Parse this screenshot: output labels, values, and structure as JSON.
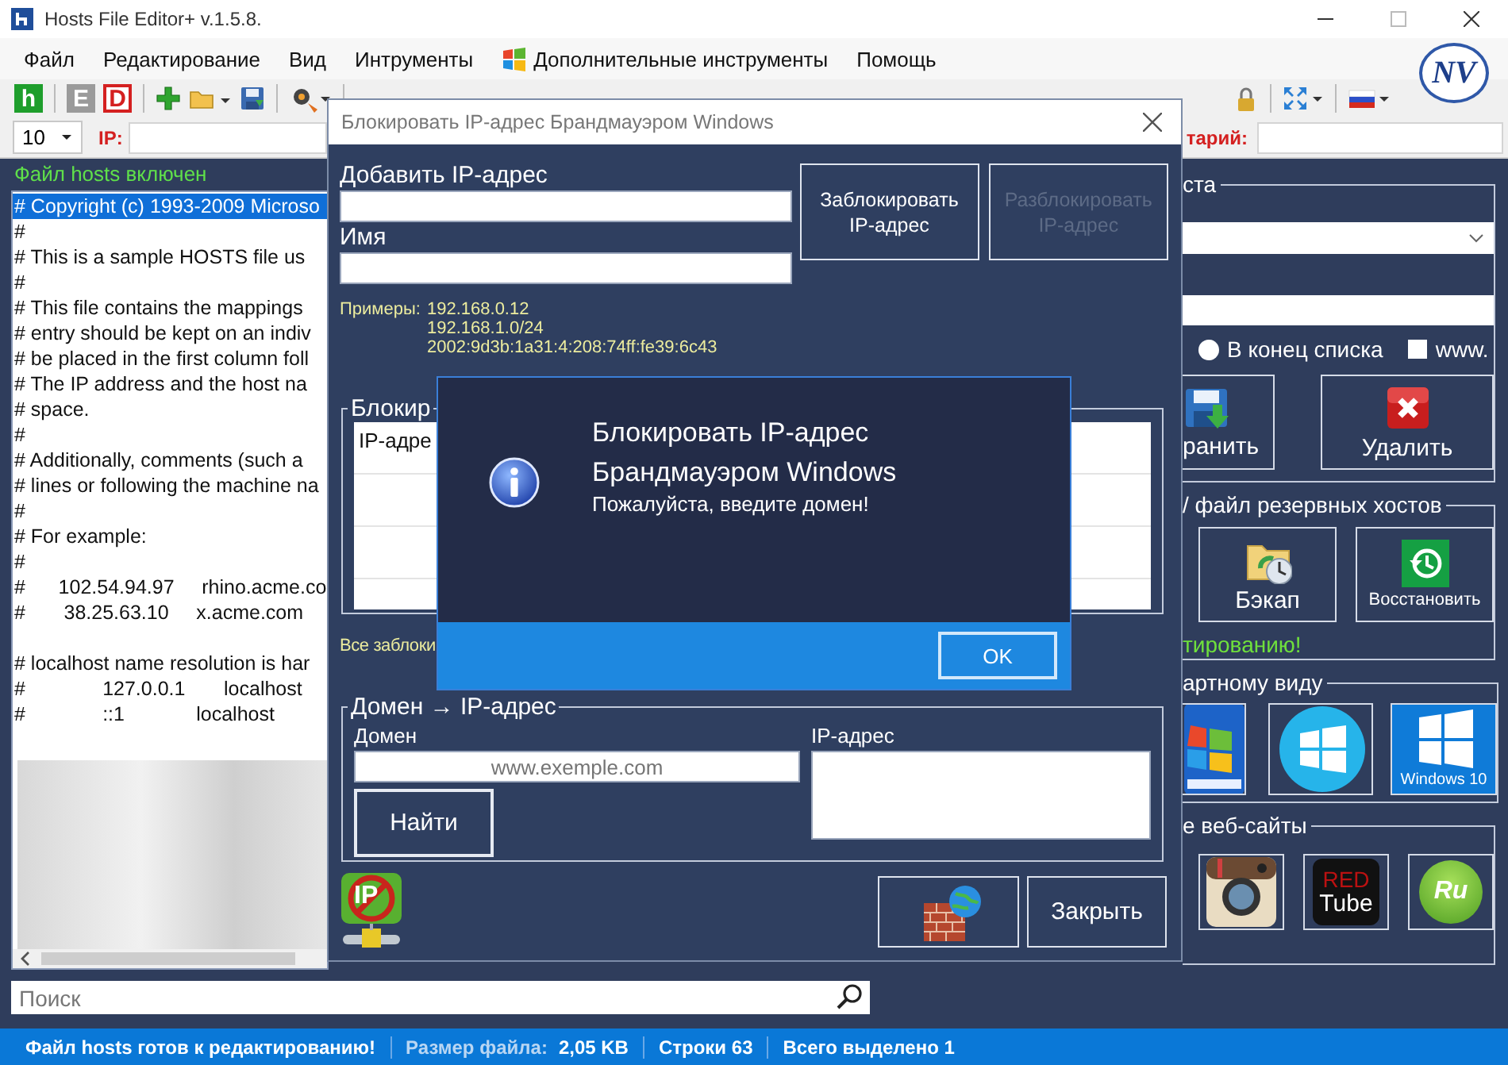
{
  "window": {
    "title": "Hosts File Editor+ v.1.5.8.",
    "logo": "NV"
  },
  "menu": [
    {
      "label": "Файл",
      "kind": "text"
    },
    {
      "label": "Редактирование",
      "kind": "text"
    },
    {
      "label": "Вид",
      "kind": "text"
    },
    {
      "label": "Интрументы",
      "kind": "text"
    },
    {
      "label": "Дополнительные инструменты",
      "kind": "icon_text"
    },
    {
      "label": "Помощь",
      "kind": "text"
    }
  ],
  "toolbar": {
    "letters": [
      {
        "char": "h",
        "kind": "filled",
        "color": "#1e9e2c"
      },
      {
        "char": "E",
        "kind": "filled",
        "color": "#9a9a9a"
      },
      {
        "char": "D",
        "kind": "outlined",
        "color": "#d42020"
      }
    ]
  },
  "filter_bar": {
    "count": "10",
    "ip_label": "IP:",
    "comment_label": "тарий:"
  },
  "editor": {
    "status": "Файл hosts включен",
    "blocks": [
      {
        "lines": [
          {
            "text": "# Copyright (c) 1993-2009 Microso",
            "selected": true
          },
          {
            "text": "#",
            "selected": false
          },
          {
            "text": "# This is a sample HOSTS file us",
            "selected": false
          },
          {
            "text": "#",
            "selected": false
          },
          {
            "text": "# This file contains the mappings",
            "selected": false
          },
          {
            "text": "# entry should be kept on an indiv",
            "selected": false
          },
          {
            "text": "# be placed in the first column foll",
            "selected": false
          },
          {
            "text": "# The IP address and the host na",
            "selected": false
          },
          {
            "text": "# space.",
            "selected": false
          },
          {
            "text": "#",
            "selected": false
          },
          {
            "text": "# Additionally, comments (such a",
            "selected": false
          },
          {
            "text": "# lines or following the machine na",
            "selected": false
          },
          {
            "text": "#",
            "selected": false
          },
          {
            "text": "# For example:",
            "selected": false
          },
          {
            "text": "#",
            "selected": false
          },
          {
            "text": "#      102.54.94.97     rhino.acme.co",
            "selected": false
          },
          {
            "text": "#       38.25.63.10     x.acme.com",
            "selected": false
          }
        ]
      },
      {
        "lines": [
          {
            "text": "# localhost name resolution is har",
            "selected": false
          },
          {
            "text": "#              127.0.0.1       localhost",
            "selected": false
          },
          {
            "text": "#              ::1             localhost",
            "selected": false
          }
        ]
      }
    ],
    "search": {
      "placeholder": "Поиск"
    }
  },
  "side_panel": {
    "entry_group": {
      "title": "ста",
      "position_option": {
        "label": "В конец списка",
        "selected": false
      },
      "www_option": {
        "label": "www.",
        "checked": false
      },
      "save_button": "ранить",
      "delete_button": "Удалить"
    },
    "backup_group": {
      "title": "/ файл резервных хостов",
      "backup_button": "Бэкап",
      "restore_button": "Восстановить",
      "note": "тированию!"
    },
    "default_group": {
      "title": "артному виду",
      "systems": [
        {
          "kind": "win7"
        },
        {
          "kind": "win8"
        },
        {
          "kind": "win10",
          "caption": "Windows 10"
        }
      ]
    },
    "sites_group": {
      "title": "е веб-сайты",
      "sites": [
        {
          "kind": "camera"
        },
        {
          "kind": "redtube",
          "caption": "RED",
          "caption_2": "Tube"
        },
        {
          "kind": "ru",
          "caption": "Ru"
        }
      ]
    }
  },
  "dialog": {
    "title": "Блокировать IP-адрес Брандмауэром Windows",
    "ip_label": "Добавить IP-адрес",
    "name_label": "Имя",
    "block_button": {
      "label": "Заблокировать IP-адрес",
      "disabled": false
    },
    "unblock_button": {
      "label": "Разблокировать IP-адрес",
      "disabled": true
    },
    "examples_label": "Примеры:",
    "examples": [
      "192.168.0.12",
      "192.168.1.0/24",
      "2002:9d3b:1a31:4:208:74ff:fe39:6c43"
    ],
    "blocked_group": {
      "title": "Блокир",
      "column_1": "IP-адре"
    },
    "blocked_note": "Все заблоки",
    "domain_group": {
      "title": "Домен → IP-адрес",
      "domain_label": "Домен",
      "domain_placeholder": "www.exemple.com",
      "ip_label": "IP-адрес",
      "find_button": "Найти"
    },
    "ip_badge": "IP",
    "close_button": "Закрыть"
  },
  "message_box": {
    "title": "Блокировать IP-адрес Брандмауэром Windows",
    "message": "Пожалуйста, введите домен!",
    "ok_button": "OK"
  },
  "status_bar": {
    "items": [
      {
        "label": "Файл hosts готов к редактированию!"
      },
      {
        "label": "Размер файла:",
        "value": "2,05 KB"
      },
      {
        "label": "Строки 63"
      },
      {
        "label": "Всего выделено 1"
      }
    ]
  }
}
